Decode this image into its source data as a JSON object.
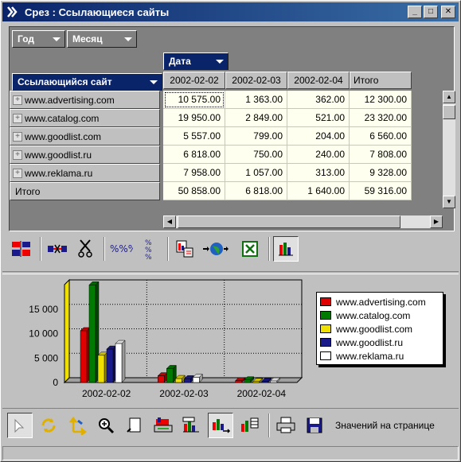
{
  "window": {
    "title": "Срез : Ссылающиеся сайты",
    "minimize_glyph": "_",
    "maximize_glyph": "□",
    "close_glyph": "✕"
  },
  "pivot": {
    "filter_fields": [
      "Год",
      "Месяц"
    ],
    "column_field": "Дата",
    "row_field": "Ссылающийся сайт",
    "column_headers": [
      "2002-02-02",
      "2002-02-03",
      "2002-02-04",
      "Итого"
    ],
    "rows": [
      {
        "label": "www.advertising.com",
        "values": [
          "10 575.00",
          "1 363.00",
          "362.00",
          "12 300.00"
        ]
      },
      {
        "label": "www.catalog.com",
        "values": [
          "19 950.00",
          "2 849.00",
          "521.00",
          "23 320.00"
        ]
      },
      {
        "label": "www.goodlist.com",
        "values": [
          "5 557.00",
          "799.00",
          "204.00",
          "6 560.00"
        ]
      },
      {
        "label": "www.goodlist.ru",
        "values": [
          "6 818.00",
          "750.00",
          "240.00",
          "7 808.00"
        ]
      },
      {
        "label": "www.reklama.ru",
        "values": [
          "7 958.00",
          "1 057.00",
          "313.00",
          "9 328.00"
        ]
      }
    ],
    "total_row": {
      "label": "Итого",
      "values": [
        "50 858.00",
        "6 818.00",
        "1 640.00",
        "59 316.00"
      ]
    }
  },
  "toolbar1": {
    "icons": [
      "pivot-layout-icon",
      "hide-column-icon",
      "cut-icon",
      "percent-icon",
      "percent-vertical-icon",
      "copy-print-icon",
      "export-web-icon",
      "export-excel-icon",
      "chart-icon"
    ]
  },
  "chart_data": {
    "type": "bar",
    "categories": [
      "2002-02-02",
      "2002-02-03",
      "2002-02-04"
    ],
    "series": [
      {
        "name": "www.advertising.com",
        "color": "#e00000",
        "values": [
          10575,
          1363,
          362
        ]
      },
      {
        "name": "www.catalog.com",
        "color": "#007a00",
        "values": [
          19950,
          2849,
          521
        ]
      },
      {
        "name": "www.goodlist.com",
        "color": "#f0e000",
        "values": [
          5557,
          799,
          204
        ]
      },
      {
        "name": "www.goodlist.ru",
        "color": "#1a1a8a",
        "values": [
          6818,
          750,
          240
        ]
      },
      {
        "name": "www.reklama.ru",
        "color": "#ffffff",
        "values": [
          7958,
          1057,
          313
        ]
      }
    ],
    "yticks": [
      "0",
      "5 000",
      "10 000",
      "15 000"
    ],
    "ylim": [
      0,
      20000
    ],
    "grid": true,
    "legend_position": "right",
    "style": "3d-bars"
  },
  "toolbar2": {
    "icons": [
      "select-arrow-icon",
      "rotate-icon",
      "move-icon",
      "zoom-icon",
      "page-icon",
      "print-preview-icon",
      "chart-bars-icon",
      "chart-options-icon",
      "chart-table-icon",
      "printer-icon",
      "save-icon"
    ],
    "label": "Значений на странице"
  }
}
